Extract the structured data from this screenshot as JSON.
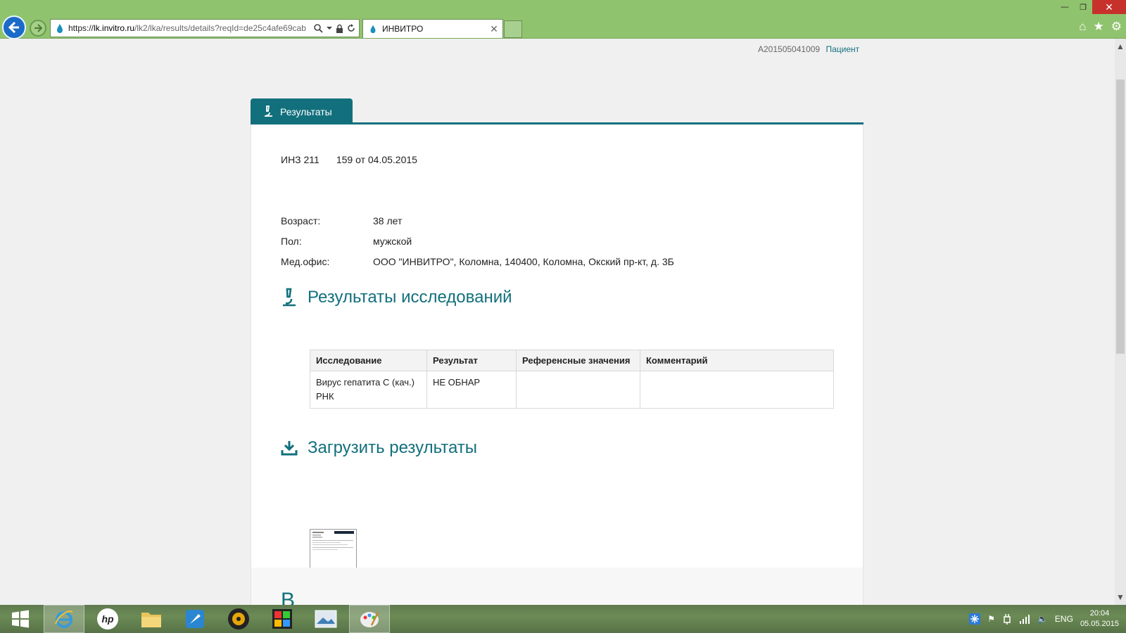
{
  "browser": {
    "url_prefix": "https://",
    "url_host": "lk.invitro.ru",
    "url_rest": "/lk2/lka/results/details?reqId=de25c4afe69cab",
    "tab_title": "ИНВИТРО"
  },
  "header": {
    "account_id": "A201505041009",
    "patient_link": "Пациент"
  },
  "tabs": {
    "results": "Результаты"
  },
  "order": {
    "code": "ИНЗ 211",
    "number": "159 от 04.05.2015"
  },
  "info": {
    "age_label": "Возраст:",
    "age_value": "38 лет",
    "sex_label": "Пол:",
    "sex_value": "мужской",
    "office_label": "Мед.офис:",
    "office_value": "ООО \"ИНВИТРО\", Коломна, 140400, Коломна, Окский пр-кт, д. 3Б"
  },
  "sections": {
    "results_title": "Результаты исследований",
    "download_title": "Загрузить результаты",
    "cut_heading_fragment": "В"
  },
  "table": {
    "headers": [
      "Исследование",
      "Результат",
      "Референсные значения",
      "Комментарий"
    ],
    "rows": [
      [
        "Вирус гепатита С (кач.) РНК",
        "НЕ ОБНАР",
        "",
        ""
      ]
    ]
  },
  "tray": {
    "lang": "ENG",
    "time": "20:04",
    "date": "05.05.2015"
  },
  "colors": {
    "brand": "#12707d",
    "chrome": "#90c36e"
  }
}
